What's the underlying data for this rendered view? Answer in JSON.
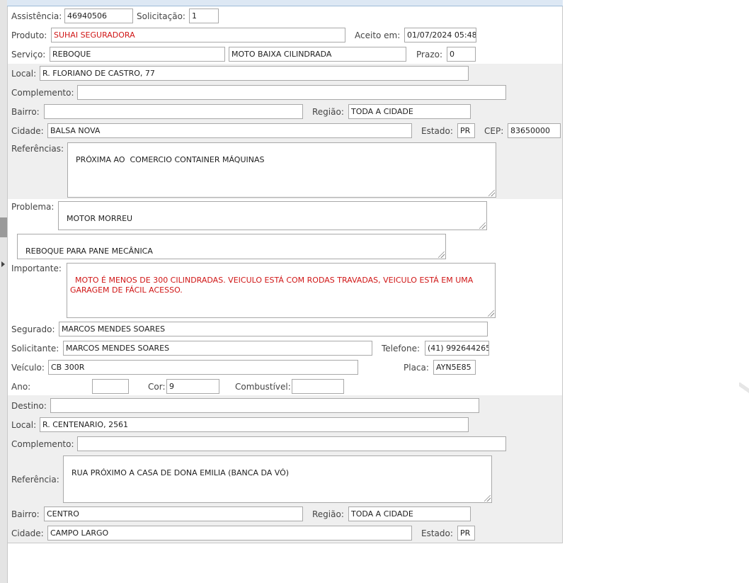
{
  "assistencia": {
    "label": "Assistência:",
    "value": "46940506"
  },
  "solicitacao": {
    "label": "Solicitação:",
    "value": "1"
  },
  "produto": {
    "label": "Produto:",
    "value": "SUHAI SEGURADORA"
  },
  "aceito": {
    "label": "Aceito em:",
    "value": "01/07/2024 05:48"
  },
  "servico": {
    "label": "Serviço:",
    "value": "REBOQUE",
    "detail": "MOTO BAIXA CILINDRADA"
  },
  "prazo": {
    "label": "Prazo:",
    "value": "0"
  },
  "origem": {
    "local": {
      "label": "Local:",
      "value": "R. FLORIANO DE CASTRO, 77"
    },
    "complemento": {
      "label": "Complemento:",
      "value": ""
    },
    "bairro": {
      "label": "Bairro:",
      "value": ""
    },
    "regiao": {
      "label": "Região:",
      "value": "TODA A CIDADE"
    },
    "cidade": {
      "label": "Cidade:",
      "value": "BALSA NOVA"
    },
    "estado": {
      "label": "Estado:",
      "value": "PR"
    },
    "cep": {
      "label": "CEP:",
      "value": "83650000"
    },
    "referencias": {
      "label": "Referências:",
      "value": "PRÓXIMA AO  COMERCIO CONTAINER MÁQUINAS"
    }
  },
  "problema": {
    "label": "Problema:",
    "value": "MOTOR MORREU",
    "detail": "REBOQUE PARA PANE MECÂNICA"
  },
  "importante": {
    "label": "Importante:",
    "value": "MOTO É MENOS DE 300 CILINDRADAS. VEICULO ESTÁ COM RODAS TRAVADAS, VEICULO ESTÁ EM UMA GARAGEM DE FÁCIL ACESSO."
  },
  "segurado": {
    "label": "Segurado:",
    "value": "MARCOS MENDES SOARES"
  },
  "solicitante": {
    "label": "Solicitante:",
    "value": "MARCOS MENDES SOARES"
  },
  "telefone": {
    "label": "Telefone:",
    "value": "(41) 992644265"
  },
  "veiculo": {
    "label": "Veículo:",
    "value": "CB 300R"
  },
  "placa": {
    "label": "Placa:",
    "value": "AYN5E85"
  },
  "ano": {
    "label": "Ano:",
    "value": ""
  },
  "cor": {
    "label": "Cor:",
    "value": "9"
  },
  "combustivel": {
    "label": "Combustível:",
    "value": ""
  },
  "destino": {
    "destino": {
      "label": "Destino:",
      "value": ""
    },
    "local": {
      "label": "Local:",
      "value": "R. CENTENARIO, 2561"
    },
    "complemento": {
      "label": "Complemento:",
      "value": ""
    },
    "referencia": {
      "label": "Referência:",
      "value": "RUA PRÓXIMO A CASA DE DONA EMILIA (BANCA DA VÓ)"
    },
    "bairro": {
      "label": "Bairro:",
      "value": "CENTRO"
    },
    "regiao": {
      "label": "Região:",
      "value": "TODA A CIDADE"
    },
    "cidade": {
      "label": "Cidade:",
      "value": "CAMPO LARGO"
    },
    "estado": {
      "label": "Estado:",
      "value": "PR"
    }
  },
  "colors": {
    "highlight_text": "#d01616",
    "band_bg": "#efefef",
    "border": "#a9a9a9"
  }
}
